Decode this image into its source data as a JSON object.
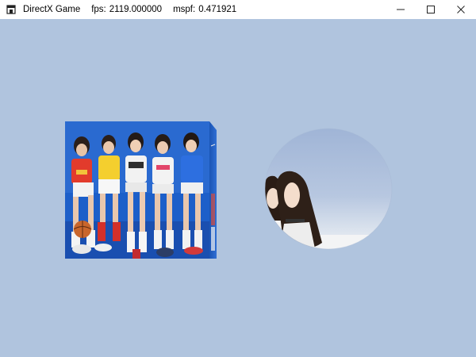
{
  "window": {
    "title": "DirectX Game",
    "fps_label": "fps:",
    "fps_value": "2119.000000",
    "mspf_label": "mspf:",
    "mspf_value": "0.471921",
    "icon": "game-window-icon",
    "controls": [
      "minimize-icon",
      "maximize-icon",
      "close-icon"
    ]
  },
  "scene": {
    "clear_color": "#B0C4DE",
    "objects": [
      {
        "type": "textured-cube",
        "texture": "photo of five people sitting on a blue floor"
      },
      {
        "type": "textured-ellipse",
        "texture": "photo of two people against a pale blue sky"
      }
    ]
  }
}
